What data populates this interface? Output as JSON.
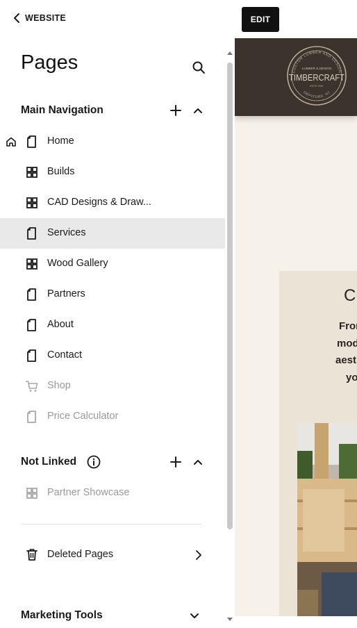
{
  "nav": {
    "back_label": "WEBSITE"
  },
  "header": {
    "title": "Pages"
  },
  "main_navigation": {
    "label": "Main Navigation",
    "items": [
      {
        "label": "Home",
        "icon": "page-icon",
        "home": true,
        "selected": false,
        "dim": false
      },
      {
        "label": "Builds",
        "icon": "grid-icon",
        "selected": false,
        "dim": false
      },
      {
        "label": "CAD Designs & Draw...",
        "icon": "grid-icon",
        "selected": false,
        "dim": false
      },
      {
        "label": "Services",
        "icon": "page-icon",
        "selected": true,
        "dim": false
      },
      {
        "label": "Wood Gallery",
        "icon": "grid-icon",
        "selected": false,
        "dim": false
      },
      {
        "label": "Partners",
        "icon": "page-icon",
        "selected": false,
        "dim": false
      },
      {
        "label": "About",
        "icon": "page-icon",
        "selected": false,
        "dim": false
      },
      {
        "label": "Contact",
        "icon": "page-icon",
        "selected": false,
        "dim": false
      },
      {
        "label": "Shop",
        "icon": "cart-icon",
        "selected": false,
        "dim": true
      },
      {
        "label": "Price Calculator",
        "icon": "page-icon",
        "selected": false,
        "dim": true
      }
    ]
  },
  "not_linked": {
    "label": "Not Linked",
    "items": [
      {
        "label": "Partner Showcase",
        "icon": "grid-icon",
        "selected": false,
        "dim": true
      }
    ]
  },
  "deleted_pages": {
    "label": "Deleted Pages"
  },
  "marketing_tools": {
    "label": "Marketing Tools"
  },
  "preview": {
    "edit_label": "EDIT",
    "logo": {
      "brand": "TIMBERCRAFT",
      "ring_text": "CUSTOM LUMBER AND DESIGN",
      "subtitle": "LUMBER & DESIGN",
      "est": "ESTD 2011",
      "location": "DEPTFORD, NJ"
    },
    "heading_fragment": "Cu",
    "paragraph_lines": [
      "Fron",
      "mod",
      "aest",
      "yo"
    ]
  },
  "colors": {
    "header_bg": "#3b332c",
    "preview_bg": "#f7f2e9",
    "card_bg": "#ece3d7",
    "selected_bg": "#e9e9e9",
    "dim_text": "#9a9a9a"
  }
}
